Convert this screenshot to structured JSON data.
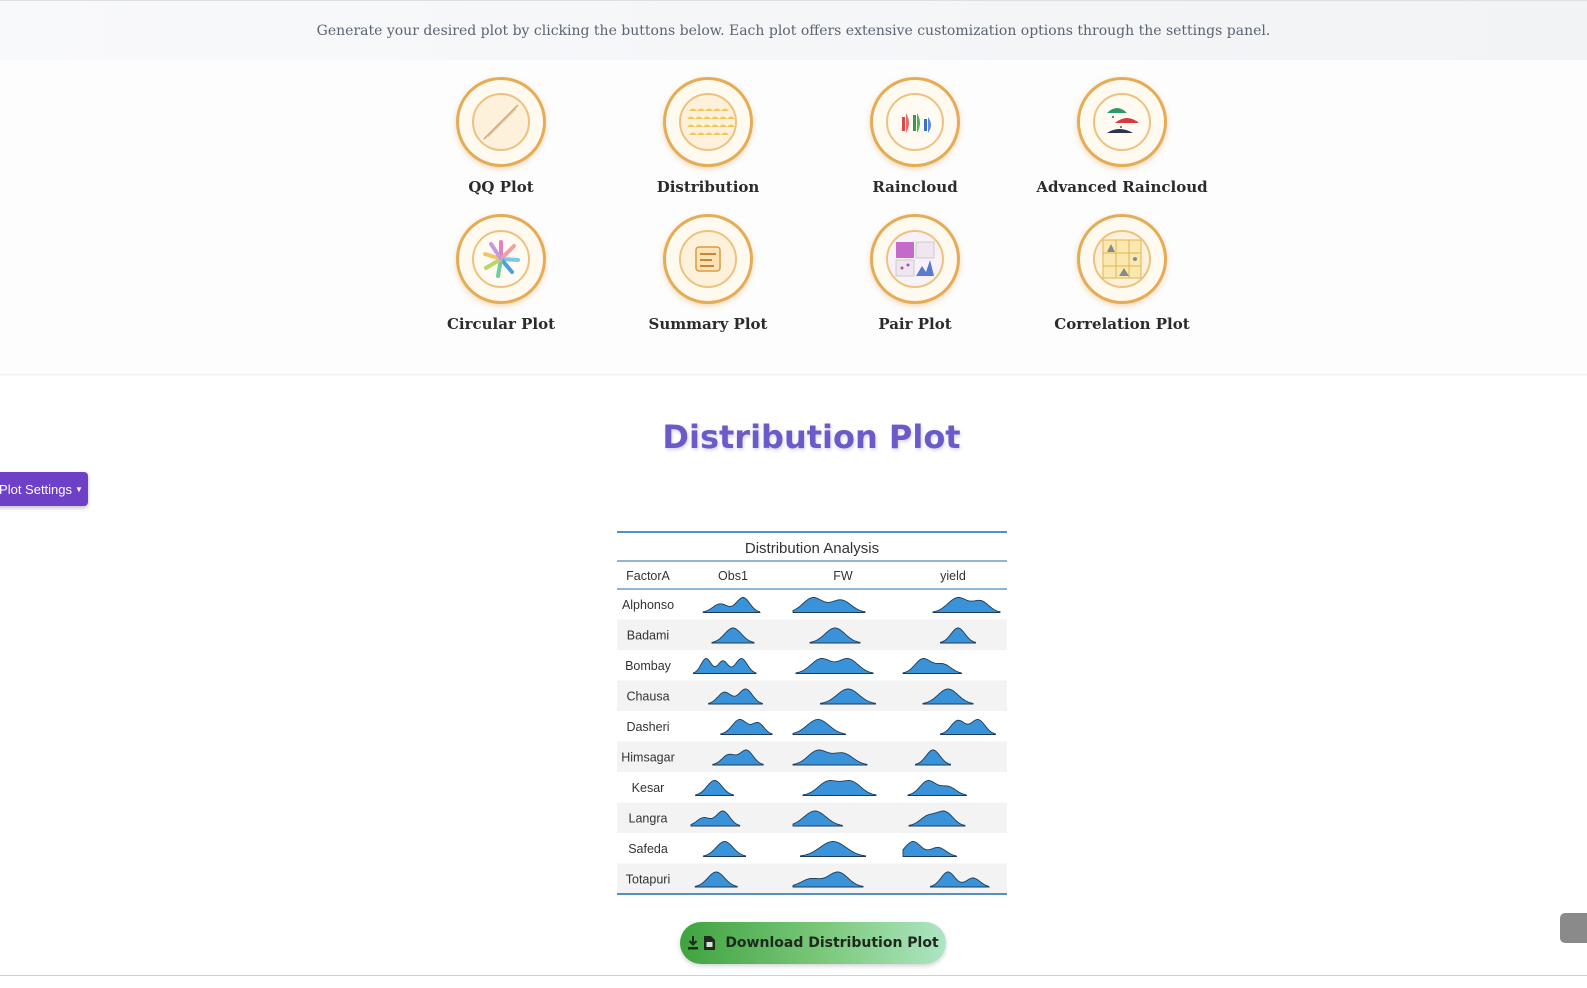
{
  "banner": {
    "text": "Generate your desired plot by clicking the buttons below. Each plot offers extensive customization options through the settings panel."
  },
  "plot_buttons": [
    {
      "label": "QQ Plot",
      "icon": "qq-plot-icon"
    },
    {
      "label": "Distribution",
      "icon": "distribution-icon"
    },
    {
      "label": "Raincloud",
      "icon": "raincloud-icon"
    },
    {
      "label": "Advanced Raincloud",
      "icon": "advanced-raincloud-icon"
    },
    {
      "label": "Circular Plot",
      "icon": "circular-plot-icon"
    },
    {
      "label": "Summary Plot",
      "icon": "summary-plot-icon"
    },
    {
      "label": "Pair Plot",
      "icon": "pair-plot-icon"
    },
    {
      "label": "Correlation Plot",
      "icon": "correlation-plot-icon"
    }
  ],
  "main": {
    "title": "Distribution Plot",
    "settings_label": "Plot Settings",
    "download_label": "Download Distribution Plot"
  },
  "colors": {
    "accent": "#6b5bc9",
    "density_fill": "#3a93d8",
    "table_rule": "#1f6fa8",
    "button_green": "#3fa33f",
    "ring": "#e6ac55"
  },
  "chart_data": {
    "type": "table",
    "title": "Distribution Analysis",
    "row_header": "FactorA",
    "columns": [
      "Obs1",
      "FW",
      "yield"
    ],
    "rows": [
      {
        "name": "Alphonso",
        "dists": [
          [
            {
              "c": 0.35,
              "s": 0.09,
              "h": 0.55
            },
            {
              "c": 0.62,
              "s": 0.08,
              "h": 0.95
            }
          ],
          [
            {
              "c": 0.2,
              "s": 0.1,
              "h": 0.95
            },
            {
              "c": 0.48,
              "s": 0.1,
              "h": 0.8
            }
          ],
          [
            {
              "c": 0.55,
              "s": 0.1,
              "h": 0.95
            },
            {
              "c": 0.78,
              "s": 0.08,
              "h": 0.7
            }
          ]
        ]
      },
      {
        "name": "Badami",
        "dists": [
          [
            {
              "c": 0.5,
              "s": 0.1,
              "h": 1.0
            }
          ],
          [
            {
              "c": 0.42,
              "s": 0.1,
              "h": 1.0
            }
          ],
          [
            {
              "c": 0.55,
              "s": 0.07,
              "h": 1.0
            }
          ]
        ]
      },
      {
        "name": "Bombay",
        "dists": [
          [
            {
              "c": 0.18,
              "s": 0.06,
              "h": 0.95
            },
            {
              "c": 0.38,
              "s": 0.06,
              "h": 0.8
            },
            {
              "c": 0.6,
              "s": 0.07,
              "h": 0.95
            }
          ],
          [
            {
              "c": 0.28,
              "s": 0.1,
              "h": 0.95
            },
            {
              "c": 0.55,
              "s": 0.1,
              "h": 0.95
            }
          ],
          [
            {
              "c": 0.2,
              "s": 0.08,
              "h": 0.95
            },
            {
              "c": 0.4,
              "s": 0.08,
              "h": 0.6
            }
          ]
        ]
      },
      {
        "name": "Chausa",
        "dists": [
          [
            {
              "c": 0.4,
              "s": 0.08,
              "h": 0.75
            },
            {
              "c": 0.65,
              "s": 0.08,
              "h": 0.95
            }
          ],
          [
            {
              "c": 0.55,
              "s": 0.11,
              "h": 1.0
            }
          ],
          [
            {
              "c": 0.45,
              "s": 0.1,
              "h": 0.95
            }
          ]
        ]
      },
      {
        "name": "Dasheri",
        "dists": [
          [
            {
              "c": 0.58,
              "s": 0.09,
              "h": 1.0
            },
            {
              "c": 0.8,
              "s": 0.07,
              "h": 0.75
            }
          ],
          [
            {
              "c": 0.25,
              "s": 0.11,
              "h": 1.0
            }
          ],
          [
            {
              "c": 0.55,
              "s": 0.07,
              "h": 0.95
            },
            {
              "c": 0.75,
              "s": 0.07,
              "h": 1.0
            }
          ]
        ]
      },
      {
        "name": "Himsagar",
        "dists": [
          [
            {
              "c": 0.45,
              "s": 0.08,
              "h": 0.7
            },
            {
              "c": 0.66,
              "s": 0.08,
              "h": 1.0
            }
          ],
          [
            {
              "c": 0.25,
              "s": 0.1,
              "h": 1.0
            },
            {
              "c": 0.5,
              "s": 0.1,
              "h": 0.8
            }
          ],
          [
            {
              "c": 0.3,
              "s": 0.07,
              "h": 1.0
            }
          ]
        ]
      },
      {
        "name": "Kesar",
        "dists": [
          [
            {
              "c": 0.28,
              "s": 0.09,
              "h": 1.0
            }
          ],
          [
            {
              "c": 0.35,
              "s": 0.1,
              "h": 0.95
            },
            {
              "c": 0.58,
              "s": 0.1,
              "h": 0.95
            }
          ],
          [
            {
              "c": 0.25,
              "s": 0.08,
              "h": 1.0
            },
            {
              "c": 0.45,
              "s": 0.08,
              "h": 0.6
            }
          ]
        ]
      },
      {
        "name": "Langra",
        "dists": [
          [
            {
              "c": 0.15,
              "s": 0.08,
              "h": 0.55
            },
            {
              "c": 0.38,
              "s": 0.08,
              "h": 1.0
            }
          ],
          [
            {
              "c": 0.22,
              "s": 0.11,
              "h": 1.0
            }
          ],
          [
            {
              "c": 0.25,
              "s": 0.08,
              "h": 0.7
            },
            {
              "c": 0.42,
              "s": 0.08,
              "h": 1.0
            }
          ]
        ]
      },
      {
        "name": "Safeda",
        "dists": [
          [
            {
              "c": 0.4,
              "s": 0.1,
              "h": 1.0
            }
          ],
          [
            {
              "c": 0.4,
              "s": 0.13,
              "h": 1.0
            }
          ],
          [
            {
              "c": 0.1,
              "s": 0.08,
              "h": 1.0
            },
            {
              "c": 0.35,
              "s": 0.08,
              "h": 0.6
            }
          ]
        ]
      },
      {
        "name": "Totapuri",
        "dists": [
          [
            {
              "c": 0.3,
              "s": 0.1,
              "h": 1.0
            }
          ],
          [
            {
              "c": 0.18,
              "s": 0.1,
              "h": 0.55
            },
            {
              "c": 0.45,
              "s": 0.1,
              "h": 1.0
            }
          ],
          [
            {
              "c": 0.45,
              "s": 0.07,
              "h": 1.0
            },
            {
              "c": 0.7,
              "s": 0.07,
              "h": 0.6
            }
          ]
        ]
      }
    ]
  }
}
